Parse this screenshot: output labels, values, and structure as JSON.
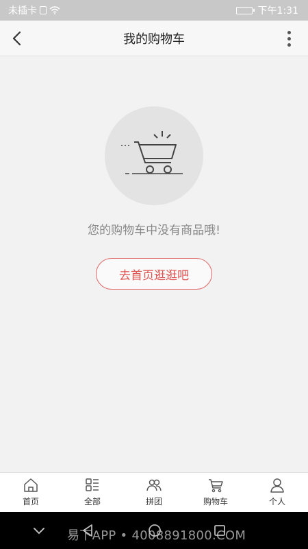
{
  "status_bar": {
    "carrier": "未插卡",
    "time": "下午1:31"
  },
  "nav": {
    "title": "我的购物车"
  },
  "empty": {
    "message": "您的购物车中没有商品哦!",
    "button_label": "去首页逛逛吧"
  },
  "tabs": [
    {
      "label": "首页",
      "icon": "home-icon"
    },
    {
      "label": "全部",
      "icon": "category-icon"
    },
    {
      "label": "拼团",
      "icon": "group-icon"
    },
    {
      "label": "购物车",
      "icon": "cart-icon"
    },
    {
      "label": "个人",
      "icon": "person-icon"
    }
  ],
  "watermark": "易下APP • 4008891800.COM",
  "colors": {
    "accent": "#e0504f",
    "status_bar_bg": "#c8c8c8",
    "page_bg": "#f2f2f2"
  }
}
